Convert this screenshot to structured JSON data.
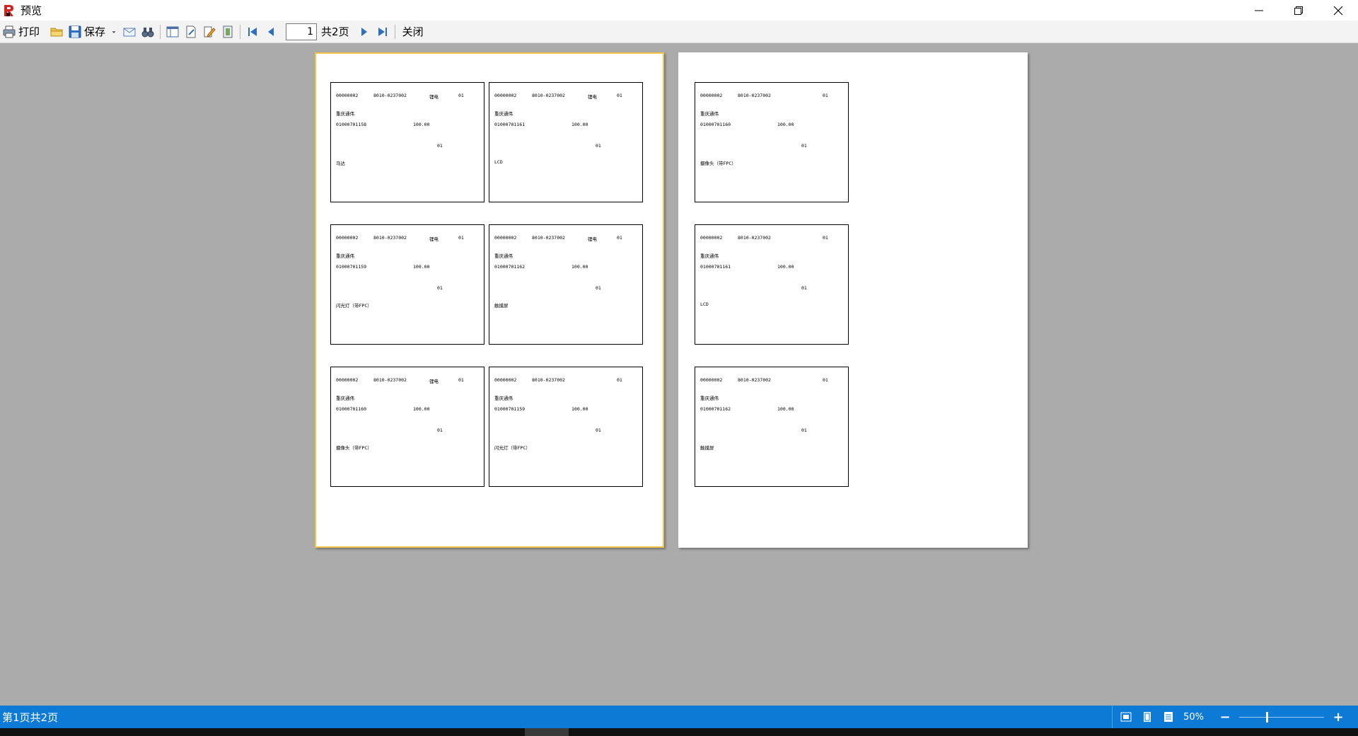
{
  "window": {
    "title": "预览"
  },
  "toolbar": {
    "print_label": "打印",
    "save_label": "保存",
    "page_value": "1",
    "page_total": "共2页",
    "close_label": "关闭"
  },
  "pages": [
    {
      "labels": [
        {
          "code": "00000002",
          "tel": "8010-0237002",
          "tag": "锂电",
          "n1": "01",
          "company": "重庆通伟",
          "barcode": "01000701158",
          "amount": "100.00",
          "n2": "01",
          "part": "马达"
        },
        {
          "code": "00000002",
          "tel": "8010-0237002",
          "tag": "锂电",
          "n1": "01",
          "company": "重庆通伟",
          "barcode": "01000701161",
          "amount": "100.00",
          "n2": "01",
          "part": "LCD"
        },
        {
          "code": "00000002",
          "tel": "8010-0237002",
          "tag": "锂电",
          "n1": "01",
          "company": "重庆通伟",
          "barcode": "01000701159",
          "amount": "100.00",
          "n2": "01",
          "part": "闪光灯（带FPC）"
        },
        {
          "code": "00000002",
          "tel": "8010-0237002",
          "tag": "锂电",
          "n1": "01",
          "company": "重庆通伟",
          "barcode": "01000701162",
          "amount": "100.00",
          "n2": "01",
          "part": "触摸屏"
        },
        {
          "code": "00000002",
          "tel": "8010-0237002",
          "tag": "锂电",
          "n1": "01",
          "company": "重庆通伟",
          "barcode": "01000701160",
          "amount": "100.00",
          "n2": "01",
          "part": "摄像头（带FPC）"
        },
        {
          "code": "00000002",
          "tel": "8010-0237002",
          "tag": "",
          "n1": "01",
          "company": "重庆通伟",
          "barcode": "01000701159",
          "amount": "100.00",
          "n2": "01",
          "part": "闪光灯（带FPC）"
        }
      ]
    },
    {
      "labels": [
        {
          "code": "00000002",
          "tel": "8010-0237002",
          "tag": "",
          "n1": "01",
          "company": "重庆通伟",
          "barcode": "01000701160",
          "amount": "100.00",
          "n2": "01",
          "part": "摄像头（带FPC）"
        },
        {
          "code": "00000002",
          "tel": "8010-0237002",
          "tag": "",
          "n1": "01",
          "company": "重庆通伟",
          "barcode": "01000701161",
          "amount": "100.00",
          "n2": "01",
          "part": "LCD"
        },
        {
          "code": "00000002",
          "tel": "8010-0237002",
          "tag": "",
          "n1": "01",
          "company": "重庆通伟",
          "barcode": "01000701162",
          "amount": "100.00",
          "n2": "01",
          "part": "触摸屏"
        }
      ]
    }
  ],
  "statusbar": {
    "page_info": "第1页共2页",
    "zoom": "50%"
  },
  "colors": {
    "accent": "#0d7ad6",
    "selection": "#f5c24a",
    "canvas": "#ababab"
  }
}
